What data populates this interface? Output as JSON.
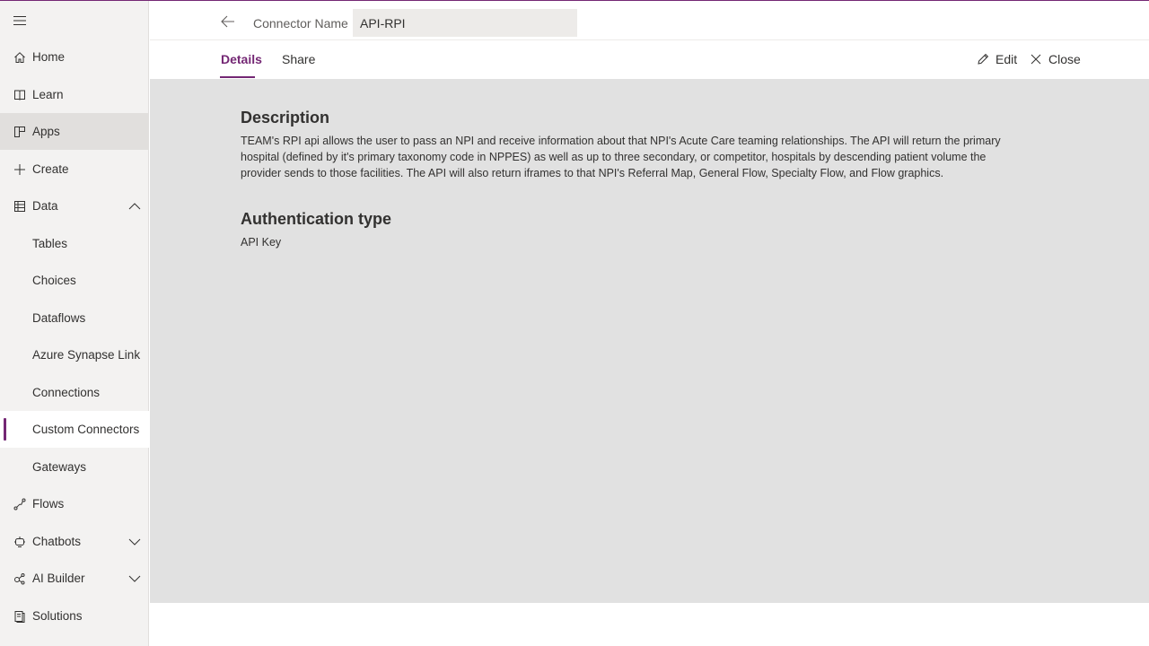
{
  "sidebar": {
    "items": [
      {
        "label": "Home",
        "icon": "home-icon"
      },
      {
        "label": "Learn",
        "icon": "book-icon"
      },
      {
        "label": "Apps",
        "icon": "apps-icon"
      },
      {
        "label": "Create",
        "icon": "plus-icon"
      },
      {
        "label": "Data",
        "icon": "table-icon",
        "expanded": true
      },
      {
        "label": "Tables"
      },
      {
        "label": "Choices"
      },
      {
        "label": "Dataflows"
      },
      {
        "label": "Azure Synapse Link"
      },
      {
        "label": "Connections"
      },
      {
        "label": "Custom Connectors",
        "selected": true
      },
      {
        "label": "Gateways"
      },
      {
        "label": "Flows",
        "icon": "flow-icon"
      },
      {
        "label": "Chatbots",
        "icon": "bot-icon",
        "expanded": false
      },
      {
        "label": "AI Builder",
        "icon": "ai-builder-icon",
        "expanded": false
      },
      {
        "label": "Solutions",
        "icon": "solutions-icon"
      }
    ]
  },
  "header": {
    "connector_label": "Connector Name",
    "connector_value": "API-RPI",
    "tabs": [
      {
        "label": "Details",
        "active": true
      },
      {
        "label": "Share"
      }
    ],
    "commands": {
      "edit": "Edit",
      "close": "Close"
    }
  },
  "content": {
    "description_title": "Description",
    "description_text": "TEAM's RPI api allows the user to pass an NPI and receive information about that NPI's Acute Care teaming relationships. The API will return the primary hospital (defined by it's primary taxonomy code in NPPES) as well as up to three secondary, or competitor, hospitals by descending patient volume the provider sends to those facilities. The API will also return iframes to that NPI's Referral Map, General Flow, Specialty Flow, and Flow graphics.",
    "auth_title": "Authentication type",
    "auth_value": "API Key"
  },
  "colors": {
    "accent": "#742774",
    "content_bg": "#e1e1e1",
    "sidebar_bg": "#f3f2f1"
  }
}
